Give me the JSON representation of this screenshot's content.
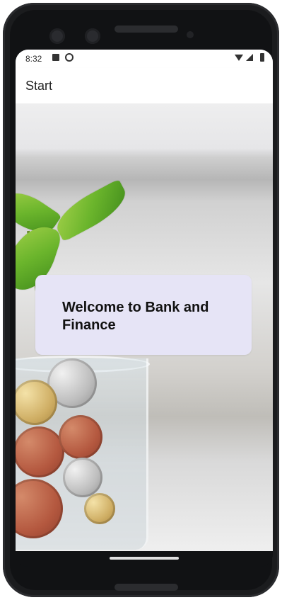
{
  "status_bar": {
    "time": "8:32",
    "icons": [
      "sim-icon",
      "sync-icon",
      "wifi-icon",
      "signal-icon",
      "battery-icon"
    ]
  },
  "app_bar": {
    "title": "Start"
  },
  "main": {
    "welcome_card": {
      "text": "Welcome to Bank and Finance"
    },
    "background_image": "plant-in-glass-of-coins"
  },
  "colors": {
    "card_background": "#e6e4f6",
    "device_frame": "#1b1c1e",
    "app_bar_background": "#ffffff"
  }
}
